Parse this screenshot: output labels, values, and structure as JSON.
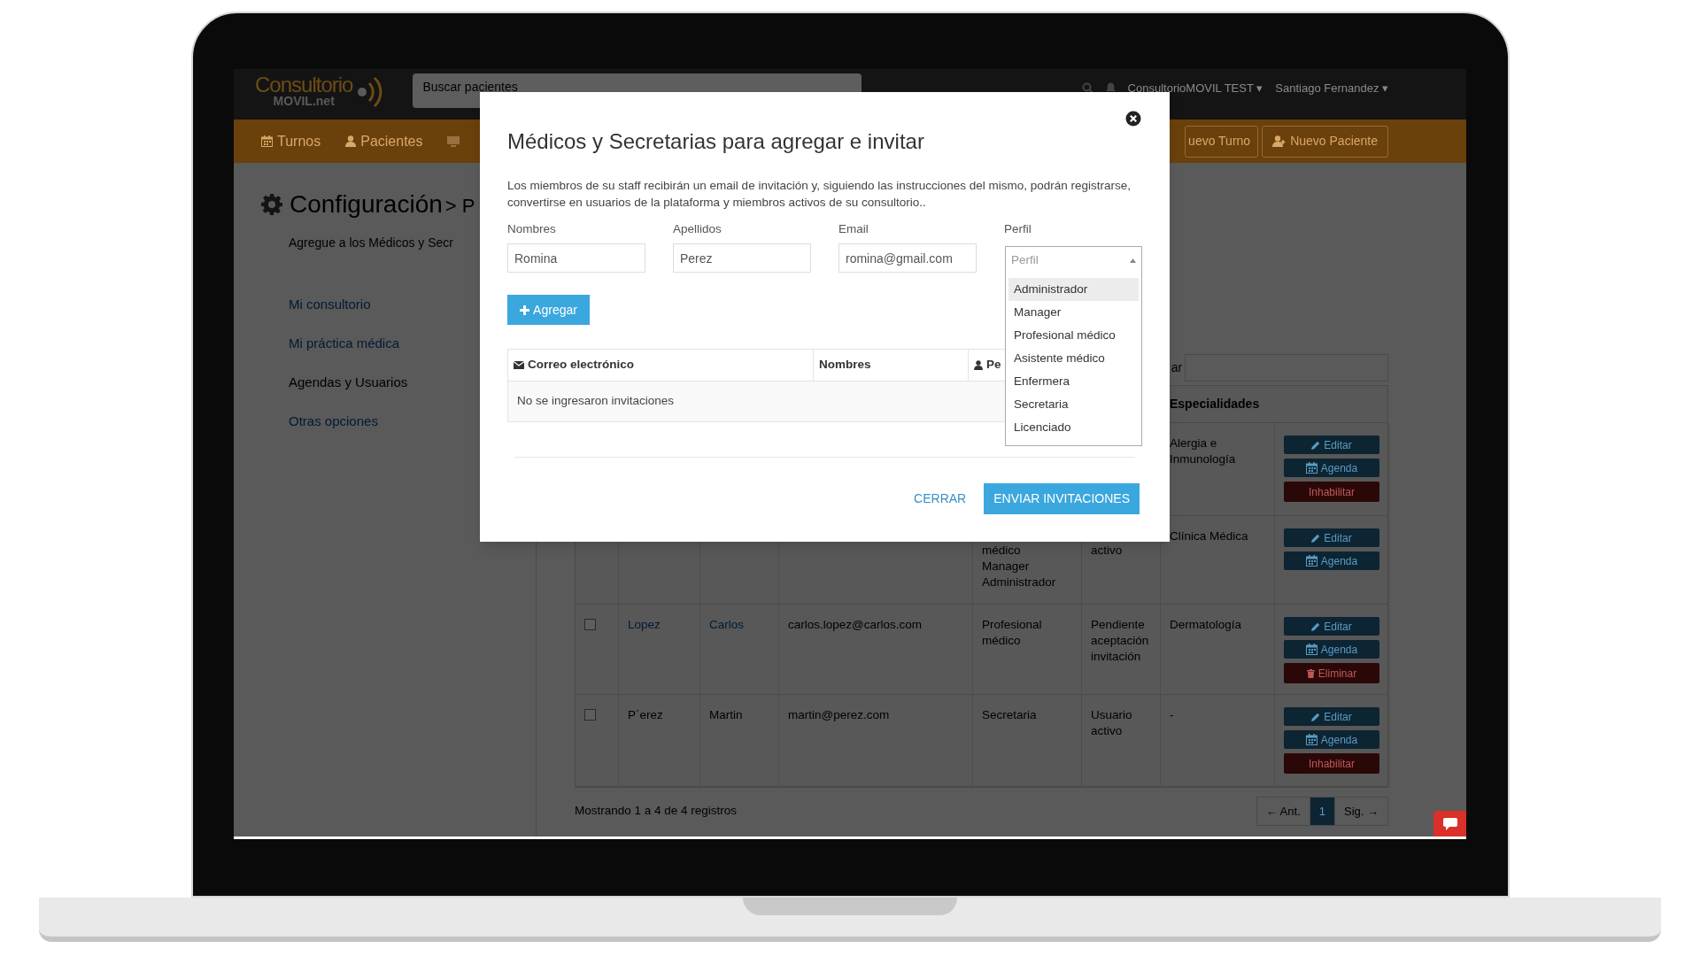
{
  "app": {
    "logo": {
      "name": "Consultorio",
      "suffix": "MOVIL.net"
    },
    "search": {
      "placeholder": "Buscar pacientes"
    },
    "account": "ConsultorioMOVIL TEST ▾",
    "user": "Santiago Fernandez ▾"
  },
  "nav": [
    {
      "label": "Turnos",
      "kind": "calendar"
    },
    {
      "label": "Pacientes",
      "kind": "patients"
    }
  ],
  "actions": [
    {
      "label": "uevo Turno",
      "kind": "turn"
    },
    {
      "label": "Nuevo Paciente",
      "kind": "patient"
    }
  ],
  "page": {
    "title": "Configuración",
    "breadcrumb": "> P",
    "subtitle": "Agregue a los Médicos y Secr"
  },
  "menu": [
    {
      "label": "Mi consultorio",
      "selected": false
    },
    {
      "label": "Mi práctica médica",
      "selected": false
    },
    {
      "label": "Agendas y Usuarios",
      "selected": true
    },
    {
      "label": "Otras opciones",
      "selected": false
    }
  ],
  "table": {
    "search_label": "ar",
    "header": "Especialidades",
    "rows": [
      {
        "specialties": "Alergia e Inmunología",
        "actions": [
          {
            "label": "Editar",
            "kind": "edit"
          },
          {
            "label": "Agenda",
            "kind": "agenda"
          },
          {
            "label": "Inhabilitar",
            "kind": "disable"
          }
        ]
      },
      {
        "profile": [
          "médico",
          "Manager",
          "Administrador"
        ],
        "status": "activo",
        "specialties": "Clínica Médica",
        "actions": [
          {
            "label": "Editar",
            "kind": "edit"
          },
          {
            "label": "Agenda",
            "kind": "agenda"
          }
        ]
      },
      {
        "checked": false,
        "linked": true,
        "last_name": "Lopez",
        "first_name": "Carlos",
        "email": "carlos.lopez@carlos.com",
        "profile": [
          "Profesional médico"
        ],
        "status": "Pendiente aceptación invitación",
        "specialties": "Dermatología",
        "actions": [
          {
            "label": "Editar",
            "kind": "edit"
          },
          {
            "label": "Agenda",
            "kind": "agenda"
          },
          {
            "label": "Eliminar",
            "kind": "delete"
          }
        ]
      },
      {
        "checked": false,
        "linked": false,
        "last_name": "P´erez",
        "first_name": "Martin",
        "email": "martin@perez.com",
        "profile": [
          "Secretaria"
        ],
        "status": "Usuario activo",
        "specialties": "-",
        "actions": [
          {
            "label": "Editar",
            "kind": "edit"
          },
          {
            "label": "Agenda",
            "kind": "agenda"
          },
          {
            "label": "Inhabilitar",
            "kind": "disable"
          }
        ]
      }
    ],
    "footer": "Mostrando 1 a 4 de 4 registros",
    "pagination": [
      {
        "label": "← Ant.",
        "selected": false
      },
      {
        "label": "1",
        "selected": true
      },
      {
        "label": "Sig. →",
        "selected": false
      }
    ]
  },
  "modal": {
    "title": "Médicos y Secretarias para agregar e invitar",
    "description": "Los miembros de su staff recibirán un email de invitación y, siguiendo las instrucciones del mismo, podrán registrarse, convertirse en usuarios de la plataforma y miembros activos de su consultorio..",
    "fields": [
      {
        "label": "Nombres",
        "value": "Romina"
      },
      {
        "label": "Apellidos",
        "value": "Perez"
      },
      {
        "label": "Email",
        "value": "romina@gmail.com"
      }
    ],
    "profile": {
      "label": "Perfil",
      "placeholder": "Perfil",
      "expanded": true,
      "options": [
        {
          "label": "Administrador",
          "selected": true
        },
        {
          "label": "Manager",
          "selected": false
        },
        {
          "label": "Profesional médico",
          "selected": false
        },
        {
          "label": "Asistente médico",
          "selected": false
        },
        {
          "label": "Enfermera",
          "selected": false
        },
        {
          "label": "Secretaria",
          "selected": false
        },
        {
          "label": "Licenciado",
          "selected": false
        }
      ]
    },
    "add_button": "Agregar",
    "columns": [
      {
        "label": "Correo electrónico",
        "kind": "email"
      },
      {
        "label": "Nombres",
        "kind": "name"
      },
      {
        "label": "Pe",
        "kind": "profile"
      }
    ],
    "empty": "No se ingresaron invitaciones",
    "buttons": [
      {
        "label": "CERRAR",
        "kind": "link"
      },
      {
        "label": "ENVIAR INVITACIONES",
        "kind": "primary"
      }
    ]
  }
}
